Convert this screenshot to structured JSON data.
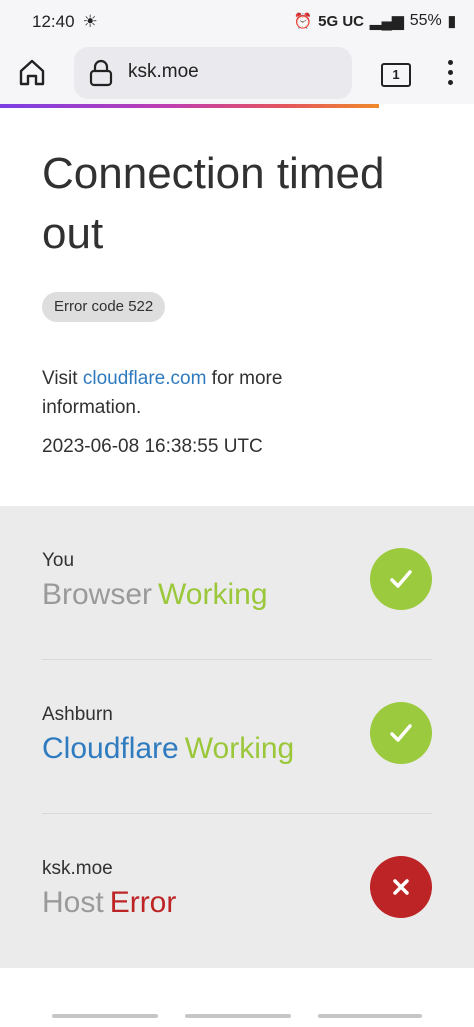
{
  "status_bar": {
    "time": "12:40",
    "network": "5G UC",
    "battery": "55%"
  },
  "browser": {
    "url": "ksk.moe",
    "tab_count": "1"
  },
  "error": {
    "title": "Connection timed out",
    "code": "Error code 522",
    "visit_prefix": "Visit ",
    "visit_link": "cloudflare.com",
    "visit_suffix": " for more information.",
    "timestamp": "2023-06-08 16:38:55 UTC"
  },
  "nodes": [
    {
      "location": "You",
      "name": "Browser",
      "status": "Working",
      "ok": true
    },
    {
      "location": "Ashburn",
      "name": "Cloudflare",
      "status": "Working",
      "ok": true
    },
    {
      "location": "ksk.moe",
      "name": "Host",
      "status": "Error",
      "ok": false
    }
  ],
  "colors": {
    "working": "#9bca3e",
    "error": "#bd2426",
    "link": "#2f7bbf"
  }
}
